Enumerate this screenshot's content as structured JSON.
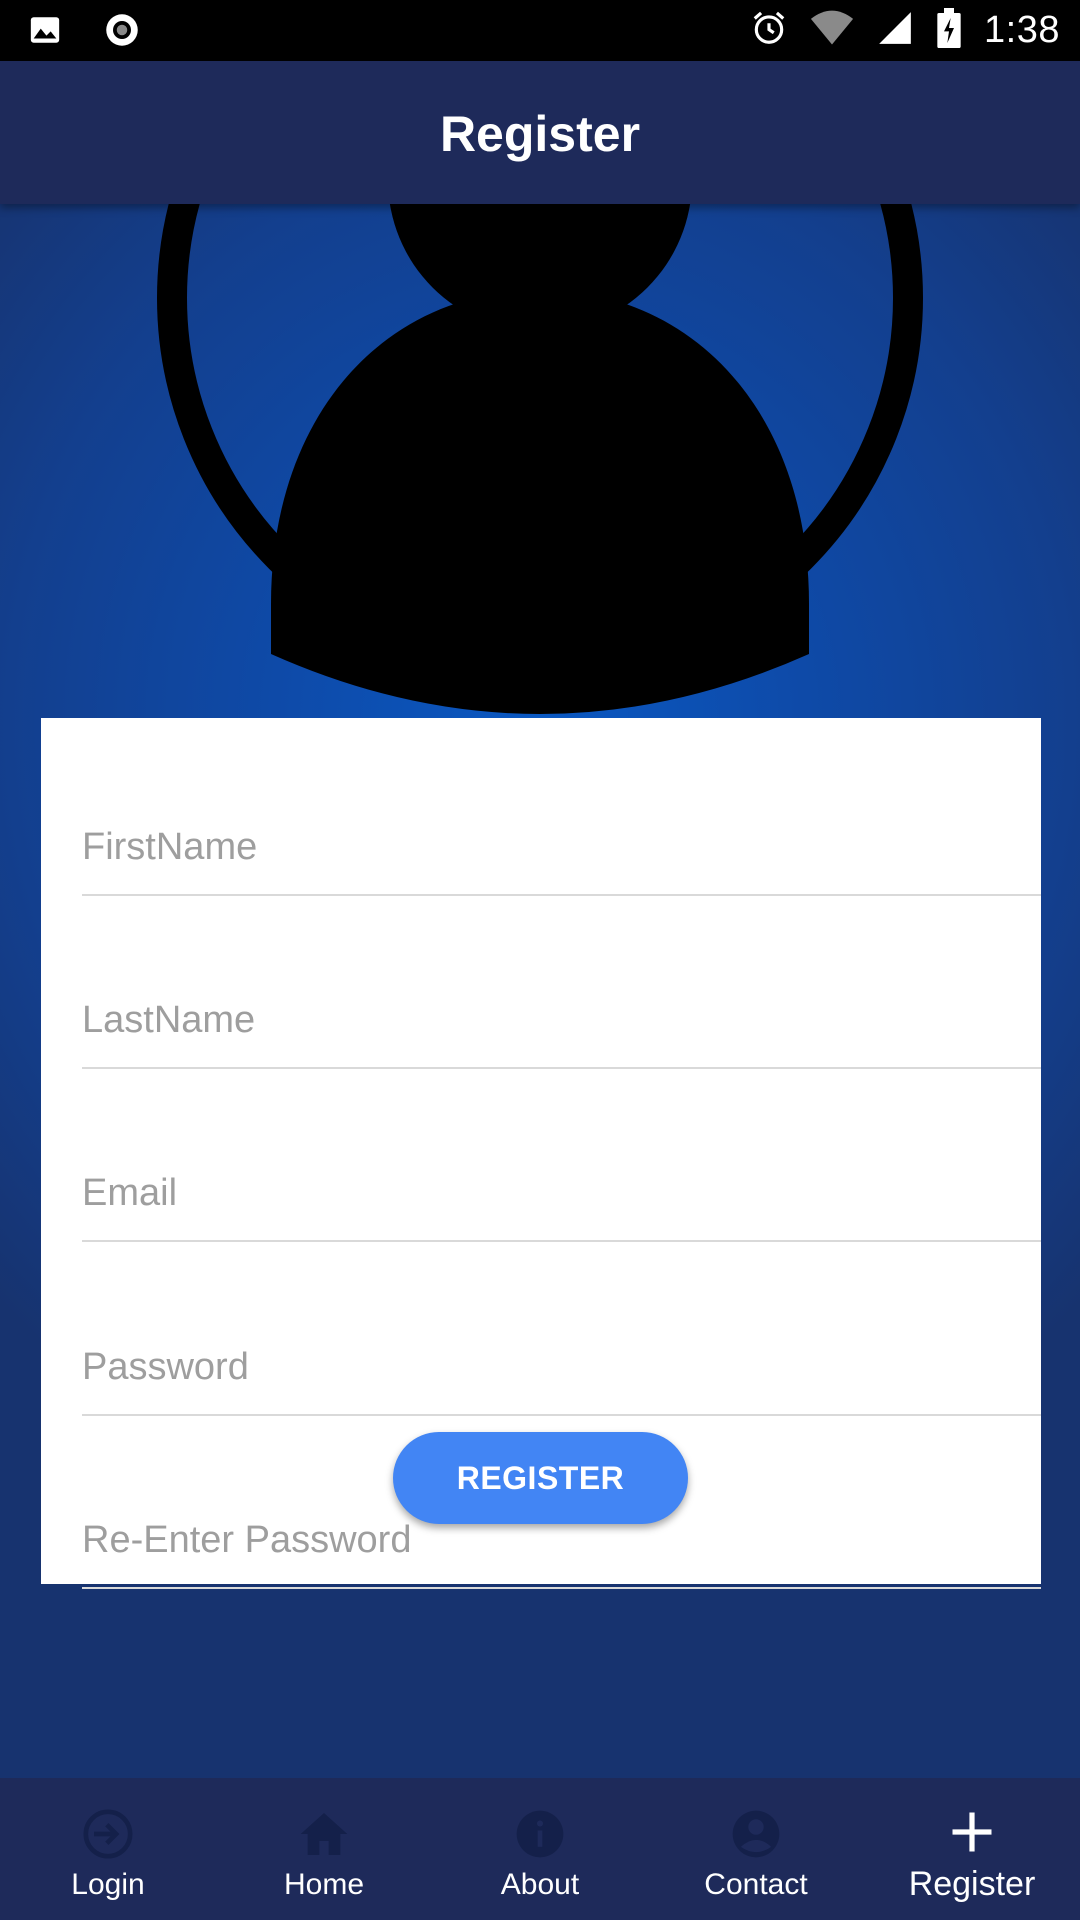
{
  "status_bar": {
    "time": "1:38",
    "icons": [
      "image-icon",
      "record-icon",
      "alarm-icon",
      "wifi-icon",
      "signal-icon",
      "battery-charging-icon"
    ]
  },
  "app_bar": {
    "title": "Register"
  },
  "avatar": {
    "icon": "user-avatar-icon"
  },
  "form": {
    "first_name": {
      "placeholder": "FirstName",
      "value": ""
    },
    "last_name": {
      "placeholder": "LastName",
      "value": ""
    },
    "email": {
      "placeholder": "Email",
      "value": ""
    },
    "password": {
      "placeholder": "Password",
      "value": ""
    },
    "reenter_password": {
      "placeholder": "Re-Enter Password",
      "value": ""
    },
    "submit_label": "REGISTER"
  },
  "bottom_nav": {
    "items": [
      {
        "label": "Login",
        "icon": "login-icon"
      },
      {
        "label": "Home",
        "icon": "home-icon"
      },
      {
        "label": "About",
        "icon": "info-icon"
      },
      {
        "label": "Contact",
        "icon": "account-circle-icon"
      },
      {
        "label": "Register",
        "icon": "plus-icon",
        "active": true
      }
    ]
  },
  "colors": {
    "status_bar": "#000000",
    "app_bar": "#1e2a5a",
    "background": "#0d4aa8",
    "button": "#4285f4",
    "nav_icon_inactive": "#14204a"
  }
}
